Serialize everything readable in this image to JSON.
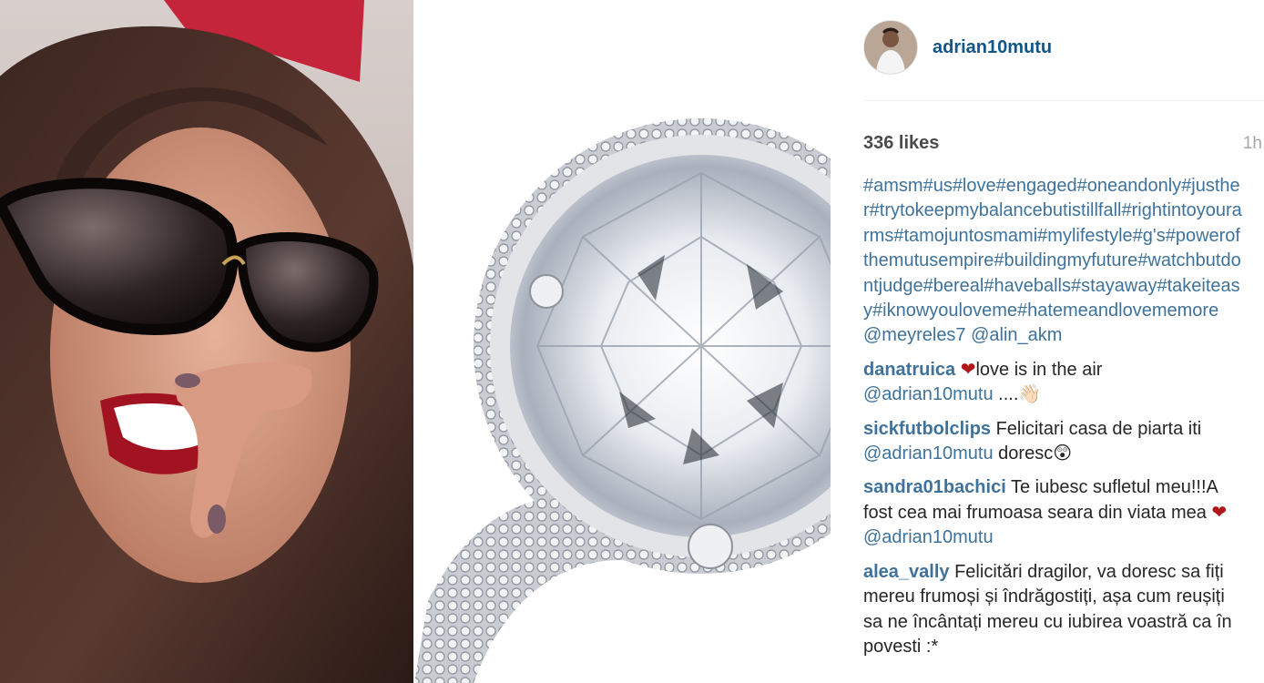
{
  "post": {
    "username": "adrian10mutu",
    "likes": "336 likes",
    "time": "1h",
    "caption": {
      "hashtags": "#amsm#us#love#engaged#oneandonly#justher#trytokeepmybalancebutistillfall#rightintoyourarms#tamojuntosmami#mylifestyle#g's#powerofthemutusempire#buildingmyfuture#watchbutdontjudge#bereal#haveballs#stayaway#takeiteasy#iknowyouloveme#hatemeandlovememore",
      "mentions": "@meyreles7 @alin_akm"
    }
  },
  "comments": [
    {
      "author": "danatruica",
      "heart": "❤",
      "text": "love is in the air",
      "mention": "@adrian10mutu",
      "trailing": " ....👋🏻"
    },
    {
      "author": "sickfutbolclips",
      "text": " Felicitari casa de piarta iti",
      "mention": "@adrian10mutu",
      "trailing": " doresc😲"
    },
    {
      "author": "sandra01bachici",
      "text": " Te iubesc sufletul meu!!!A fost cea mai frumoasa seara din viata mea ",
      "heart": "❤",
      "mention": " @adrian10mutu"
    },
    {
      "author": "alea_vally",
      "text": " Felicitări dragilor, va doresc sa fiți mereu frumoși și îndrăgostiți, așa cum reușiți sa ne încântați mereu cu iubirea voastră ca în povesti :*"
    }
  ],
  "colors": {
    "link": "#3f729b",
    "username": "#125688",
    "heart": "#b0171b"
  }
}
